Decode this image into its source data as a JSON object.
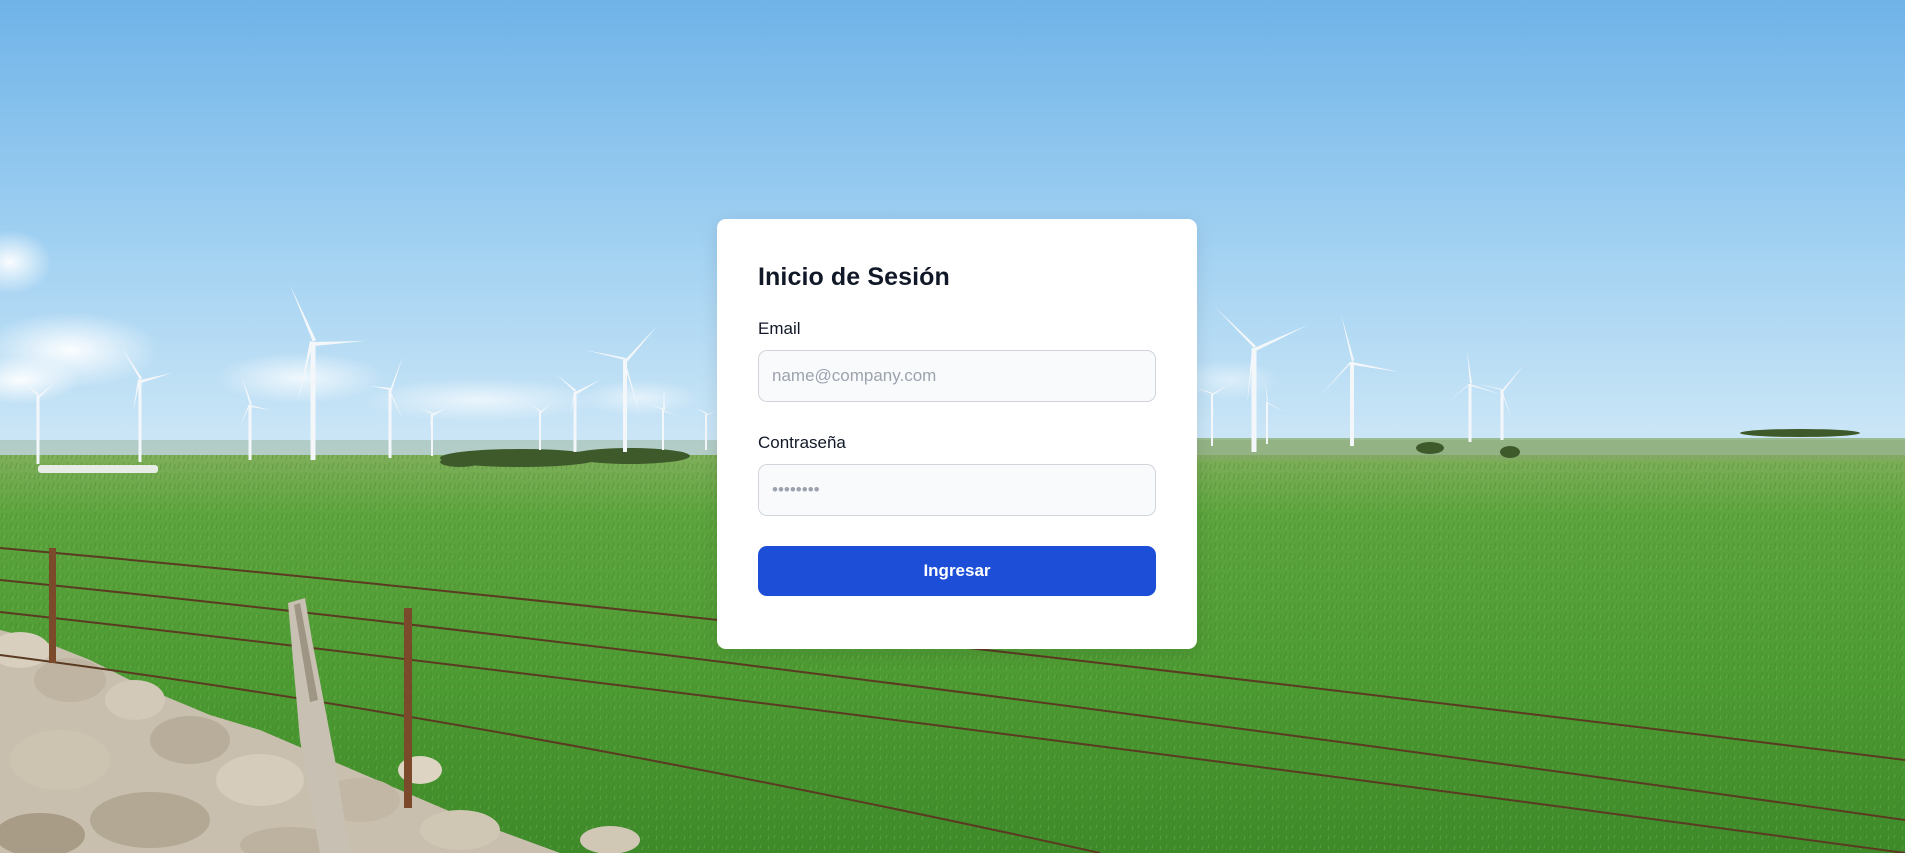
{
  "login": {
    "title": "Inicio de Sesión",
    "email_label": "Email",
    "email_placeholder": "name@company.com",
    "email_value": "",
    "password_label": "Contraseña",
    "password_placeholder": "••••••••",
    "password_value": "",
    "submit_label": "Ingresar"
  },
  "colors": {
    "primary_button": "#1d4ed8",
    "card_background": "#ffffff",
    "input_background": "#f9fafb",
    "sky_top": "#6fb3e8",
    "field_green": "#4f9a35"
  }
}
